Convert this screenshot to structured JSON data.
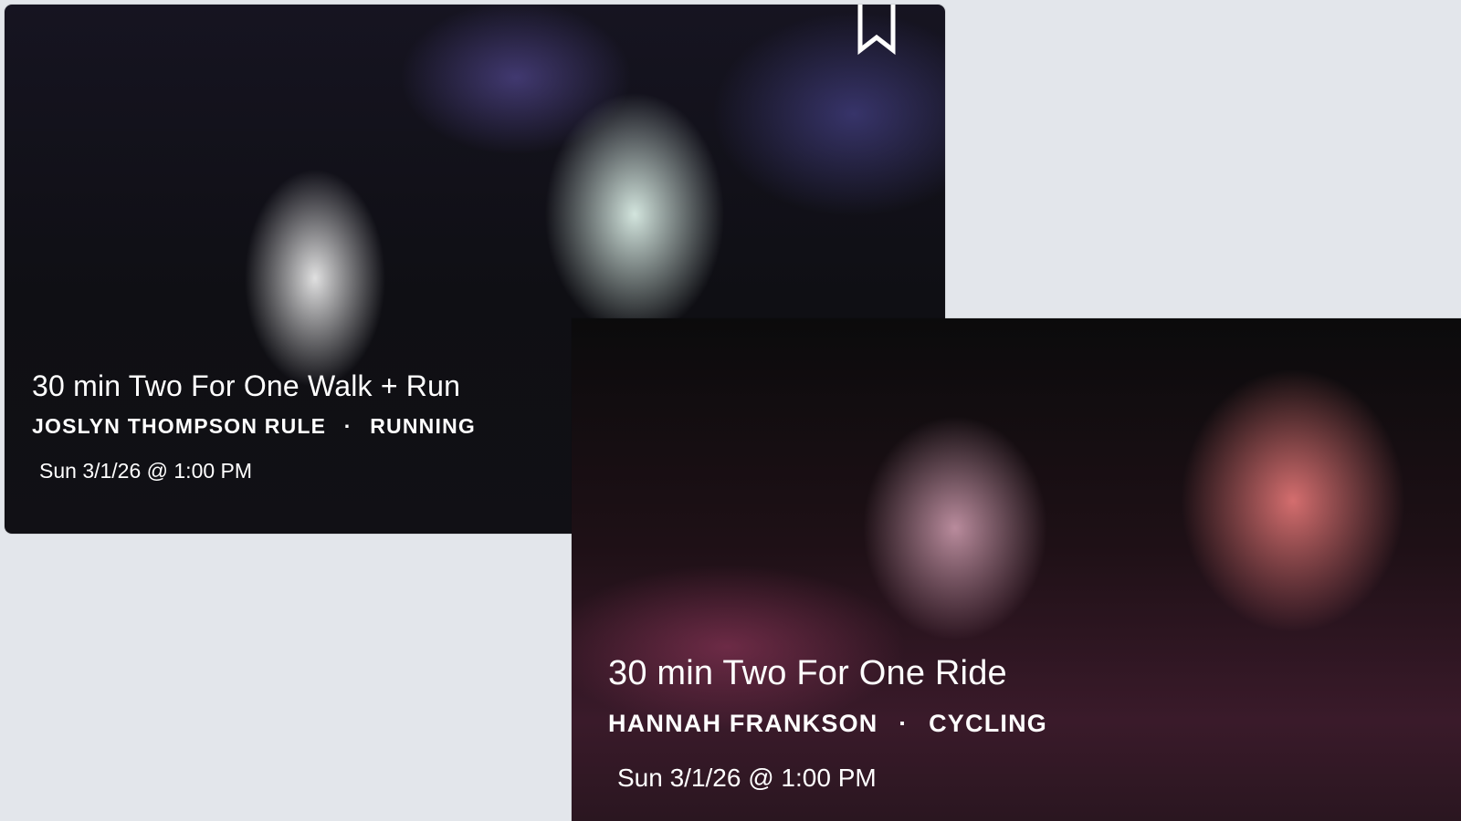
{
  "cards": [
    {
      "title": "30 min Two For One Walk + Run",
      "instructor": "JOSLYN THOMPSON RULE",
      "separator": "·",
      "discipline": "RUNNING",
      "datetime": "Sun 3/1/26 @ 1:00 PM",
      "bookmark_icon": "bookmark-icon"
    },
    {
      "title": "30 min Two For One Ride",
      "instructor": "HANNAH FRANKSON",
      "separator": "·",
      "discipline": "CYCLING",
      "datetime": "Sun 3/1/26 @ 1:00 PM"
    }
  ]
}
